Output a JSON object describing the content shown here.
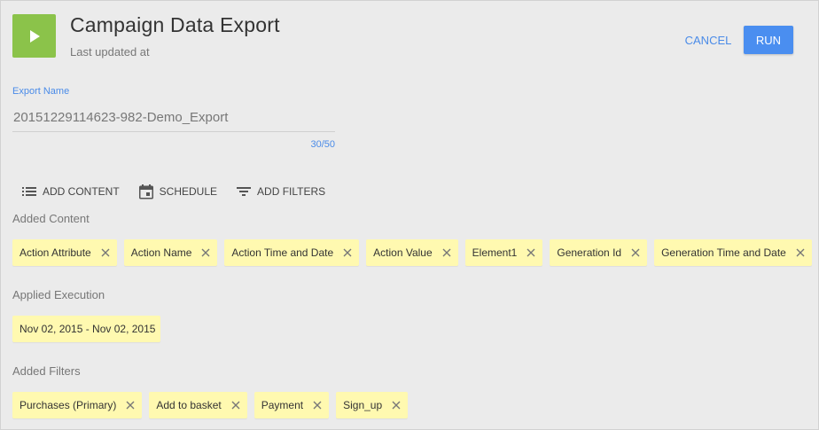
{
  "header": {
    "title": "Campaign Data Export",
    "subtitle": "Last updated at",
    "icon": "play-icon",
    "accent_color": "#8bc34a"
  },
  "actions": {
    "cancel_label": "CANCEL",
    "run_label": "RUN",
    "primary_color": "#4a8ef0"
  },
  "export_name": {
    "label": "Export Name",
    "value": "20151229114623-982-Demo_Export",
    "counter": "30/50"
  },
  "toolbar": {
    "add_content": "ADD CONTENT",
    "schedule": "SCHEDULE",
    "add_filters": "ADD FILTERS"
  },
  "added_content": {
    "title": "Added Content",
    "chips": [
      "Action Attribute",
      "Action Name",
      "Action Time and Date",
      "Action Value",
      "Element1",
      "Generation Id",
      "Generation Time and Date"
    ]
  },
  "applied_execution": {
    "title": "Applied Execution",
    "chips": [
      "Nov 02, 2015 - Nov 02, 2015"
    ]
  },
  "added_filters": {
    "title": "Added Filters",
    "chips": [
      "Purchases (Primary)",
      "Add to basket",
      "Payment",
      "Sign_up"
    ]
  },
  "chip_color": "#fff9b0"
}
